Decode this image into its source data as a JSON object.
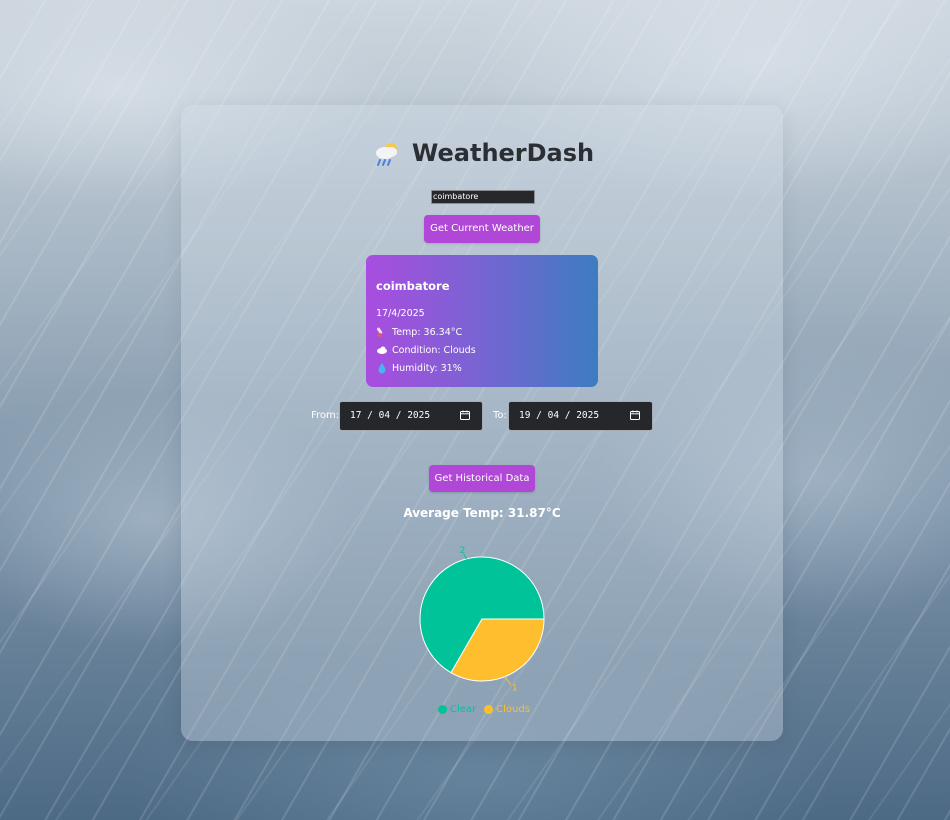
{
  "app": {
    "title": "WeatherDash",
    "title_icon": "cloud-rain-sun-icon"
  },
  "search": {
    "value": "coimbatore",
    "button_label": "Get Current Weather"
  },
  "current": {
    "city": "coimbatore",
    "date": "17/4/2025",
    "temp": "Temp: 36.34°C",
    "condition": "Condition: Clouds",
    "humidity": "Humidity: 31%",
    "icons": {
      "temp": "thermometer-icon",
      "condition": "cloud-icon",
      "humidity": "droplet-icon"
    }
  },
  "history": {
    "from_label": "From:",
    "to_label": "To:",
    "from_value": "17 / 04 / 2025",
    "to_value": "19 / 04 / 2025",
    "button_label": "Get Historical Data",
    "average": "Average Temp: 31.87°C"
  },
  "colors": {
    "accent": "#b047d6",
    "clear": "#00c39a",
    "clouds": "#ffbe2e"
  },
  "chart_data": {
    "type": "pie",
    "categories": [
      "Clear",
      "Clouds"
    ],
    "values": [
      2,
      1
    ],
    "labels": [
      "2",
      "1"
    ],
    "colors": [
      "#00c39a",
      "#ffbe2e"
    ],
    "legend_position": "bottom"
  }
}
